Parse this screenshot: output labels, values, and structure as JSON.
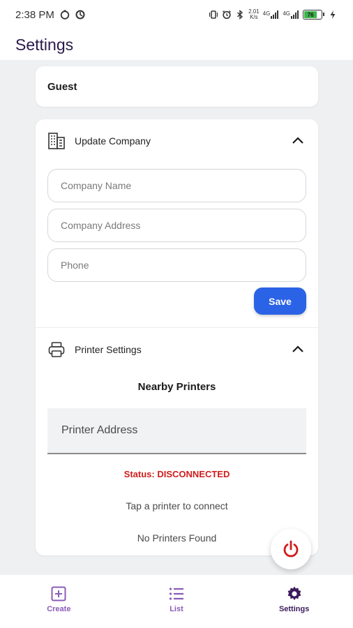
{
  "status_bar": {
    "time": "2:38 PM",
    "network_speed": "2.01",
    "network_unit": "K/s",
    "signal_1": "4G",
    "signal_2": "4G",
    "battery_level": "76"
  },
  "app_bar": {
    "title": "Settings"
  },
  "guest": {
    "name": "Guest"
  },
  "update_company": {
    "title": "Update Company",
    "company_name_placeholder": "Company Name",
    "company_address_placeholder": "Company Address",
    "phone_placeholder": "Phone",
    "save_label": "Save"
  },
  "printer_settings": {
    "title": "Printer Settings",
    "nearby_title": "Nearby Printers",
    "printer_address_placeholder": "Printer Address",
    "status": "Status: DISCONNECTED",
    "hint": "Tap a printer to connect",
    "empty": "No Printers Found"
  },
  "bottom_nav": {
    "items": [
      {
        "label": "Create",
        "icon": "add-box-icon",
        "color": "#8a5cb8"
      },
      {
        "label": "List",
        "icon": "list-icon",
        "color": "#8a5cb8"
      },
      {
        "label": "Settings",
        "icon": "gear-icon",
        "color": "#3d1c5c"
      }
    ]
  },
  "colors": {
    "accent": "#2b63e6",
    "status_error": "#d01c1c",
    "power": "#d01c1c",
    "title": "#2a1a4a"
  }
}
